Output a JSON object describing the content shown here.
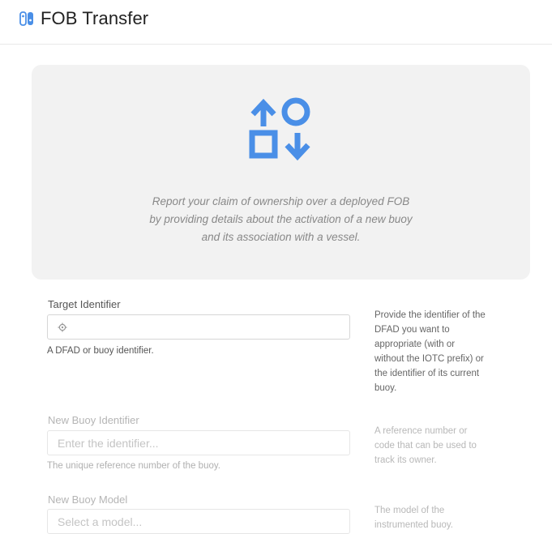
{
  "header": {
    "title": "FOB Transfer",
    "icon": "switch-icon",
    "accent": "#4a8fe7"
  },
  "hero": {
    "icon": "shapes-transfer-icon",
    "lines": [
      "Report your claim of ownership over a deployed FOB",
      "by providing details about the activation of a new buoy",
      "and its association with a vessel."
    ]
  },
  "form": {
    "target": {
      "label": "Target Identifier",
      "icon": "target-icon",
      "value": "",
      "help": "A DFAD or buoy identifier.",
      "description": [
        "Provide the identifier of the",
        "DFAD you want to",
        "appropriate (with or",
        "without the IOTC prefix) or",
        "the identifier of its current",
        "buoy."
      ]
    },
    "buoy_id": {
      "label": "New Buoy Identifier",
      "placeholder": "Enter the identifier...",
      "help": "The unique reference number of the buoy.",
      "description": [
        "A reference number or",
        "code that can be used to",
        "track its owner."
      ]
    },
    "buoy_model": {
      "label": "New Buoy Model",
      "placeholder": "Select a model...",
      "description": [
        "The model of the",
        "instrumented buoy."
      ]
    }
  }
}
